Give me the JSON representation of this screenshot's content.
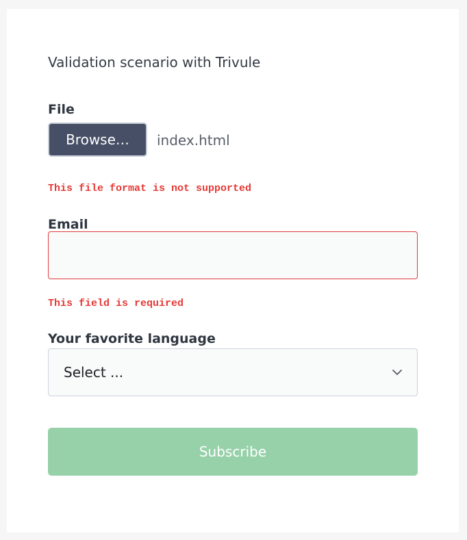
{
  "intro": "Validation scenario with Trivule",
  "file_field": {
    "label": "File",
    "browse_label": "Browse…",
    "file_name": "index.html",
    "error": "This file format is not supported"
  },
  "email_field": {
    "label": "Email",
    "value": "",
    "placeholder": "",
    "error": "This field is required"
  },
  "language_field": {
    "label": "Your favorite language",
    "selected": "Select ..."
  },
  "submit": {
    "label": "Subscribe"
  },
  "colors": {
    "error": "#e53935",
    "browse_bg": "#464f66",
    "submit_bg": "#96d1aa",
    "text": "#2f3640"
  },
  "icons": {
    "select_arrow": "chevron-down-icon"
  }
}
